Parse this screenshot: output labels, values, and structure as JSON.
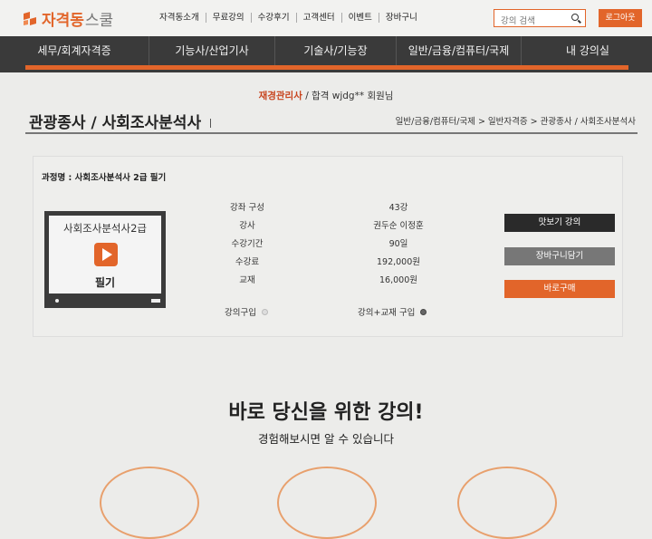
{
  "brand": {
    "name_bold": "자격동",
    "name_light": "스쿨"
  },
  "top_nav": [
    "자격동소개",
    "무료강의",
    "수강후기",
    "고객센터",
    "이벤트",
    "장바구니"
  ],
  "search": {
    "placeholder": "강의 검색"
  },
  "login_label": "로그아웃",
  "main_nav": [
    "세무/회계자격증",
    "기능사/산업기사",
    "기술사/기능장",
    "일반/금융/컴퓨터/국제",
    "내 강의실"
  ],
  "notice": {
    "highlight": "재경관리사",
    "rest": "/ 합격 wjdg** 회원님"
  },
  "page_title": "관광종사 / 사회조사분석사",
  "breadcrumb": "일반/금융/컴퓨터/국제 > 일반자격증 > 관광종사 / 사회조사분석사",
  "course": {
    "name_line": "과정명 : 사회조사분석사 2급 필기",
    "thumb_title": "사회조사분석사2급",
    "thumb_sub": "필기",
    "info": [
      {
        "label": "강좌 구성",
        "value": "43강"
      },
      {
        "label": "강사",
        "value": "권두순 이정훈"
      },
      {
        "label": "수강기간",
        "value": "90일"
      },
      {
        "label": "수강료",
        "value": "192,000원"
      },
      {
        "label": "교재",
        "value": "16,000원"
      }
    ],
    "options": [
      {
        "label": "강의구입",
        "selected": false
      },
      {
        "label": "강의+교재 구입",
        "selected": true
      }
    ],
    "buttons": {
      "preview": "맛보기 강의",
      "cart": "장바구니담기",
      "buy": "바로구매"
    }
  },
  "promo": {
    "title": "바로 당신을 위한 강의!",
    "subtitle": "경험해보시면 알 수 있습니다"
  },
  "colors": {
    "accent": "#e2652a",
    "nav_bg": "#3a3a3a",
    "notice_highlight": "#c8451f"
  }
}
